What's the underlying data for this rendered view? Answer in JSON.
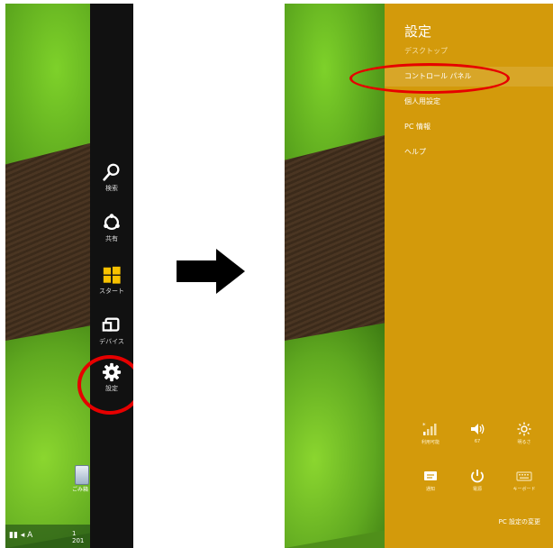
{
  "left": {
    "charms": {
      "search": "検索",
      "share": "共有",
      "start": "スタート",
      "devices": "デバイス",
      "settings": "設定"
    },
    "taskbar": {
      "tray_text": "▮▮ ◂ A",
      "clock_line1": "1",
      "clock_line2": "201"
    },
    "desktop": {
      "recycle_bin_label": "ごみ箱"
    }
  },
  "right": {
    "settings_pane": {
      "title": "設定",
      "items": [
        "デスクトップ",
        "コントロール パネル",
        "個人用設定",
        "PC 情報",
        "ヘルプ"
      ],
      "quick_settings": [
        {
          "label": "利用可能",
          "icon": "network-icon"
        },
        {
          "label": "67",
          "icon": "volume-icon"
        },
        {
          "label": "明るさ",
          "icon": "brightness-icon"
        },
        {
          "label": "通知",
          "icon": "notifications-icon"
        },
        {
          "label": "電源",
          "icon": "power-icon"
        },
        {
          "label": "キーボード",
          "icon": "keyboard-icon"
        }
      ],
      "footer_link": "PC 設定の変更"
    }
  },
  "colors": {
    "charms_bar": "#111111",
    "settings_pane": "#d39a0b",
    "highlight": "#e60000",
    "arrow": "#000000"
  }
}
